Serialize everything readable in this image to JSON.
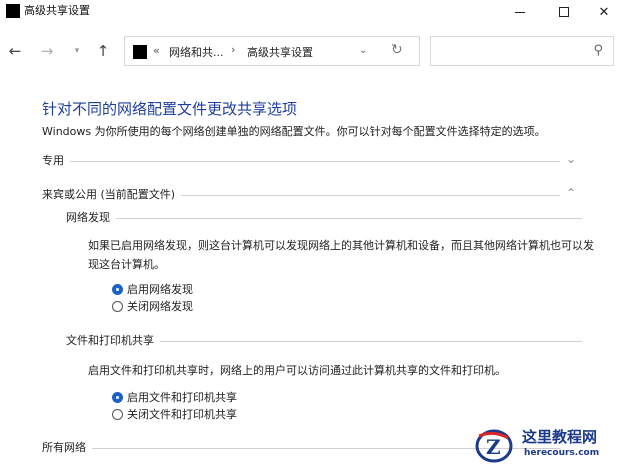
{
  "window": {
    "title": "高级共享设置",
    "controls": {
      "minimize": "minimize-icon",
      "maximize": "maximize-icon",
      "close": "close-icon"
    }
  },
  "nav": {
    "back_icon": "back-arrow-icon",
    "forward_icon": "forward-arrow-icon",
    "history_icon": "chevron-down-icon",
    "up_icon": "up-arrow-icon",
    "address": {
      "overflow": "«",
      "crumbs": [
        "网络和共...",
        "高级共享设置"
      ],
      "separator": "›"
    },
    "search": {
      "placeholder": "",
      "icon": "search-icon"
    }
  },
  "content": {
    "heading": "针对不同的网络配置文件更改共享选项",
    "description": "Windows 为你所使用的每个网络创建单独的网络配置文件。你可以针对每个配置文件选择特定的选项。",
    "sections": {
      "private": {
        "title": "专用",
        "state": "collapsed"
      },
      "guest_public": {
        "title": "来宾或公用 (当前配置文件)",
        "state": "expanded",
        "network_discovery": {
          "title": "网络发现",
          "text": "如果已启用网络发现，则这台计算机可以发现网络上的其他计算机和设备，而且其他网络计算机也可以发现这台计算机。",
          "options": [
            "启用网络发现",
            "关闭网络发现"
          ],
          "selected": 0
        },
        "file_printer_sharing": {
          "title": "文件和打印机共享",
          "text": "启用文件和打印机共享时，网络上的用户可以访问通过此计算机共享的文件和打印机。",
          "options": [
            "启用文件和打印机共享",
            "关闭文件和打印机共享"
          ],
          "selected": 0
        }
      },
      "all_networks": {
        "title": "所有网络"
      }
    }
  },
  "watermark": {
    "title": "这里教程网",
    "url": "herecours.com",
    "color": "#1c3a8a"
  },
  "colors": {
    "heading": "#1e3f9e",
    "radio_checked": "#1a62c4"
  }
}
